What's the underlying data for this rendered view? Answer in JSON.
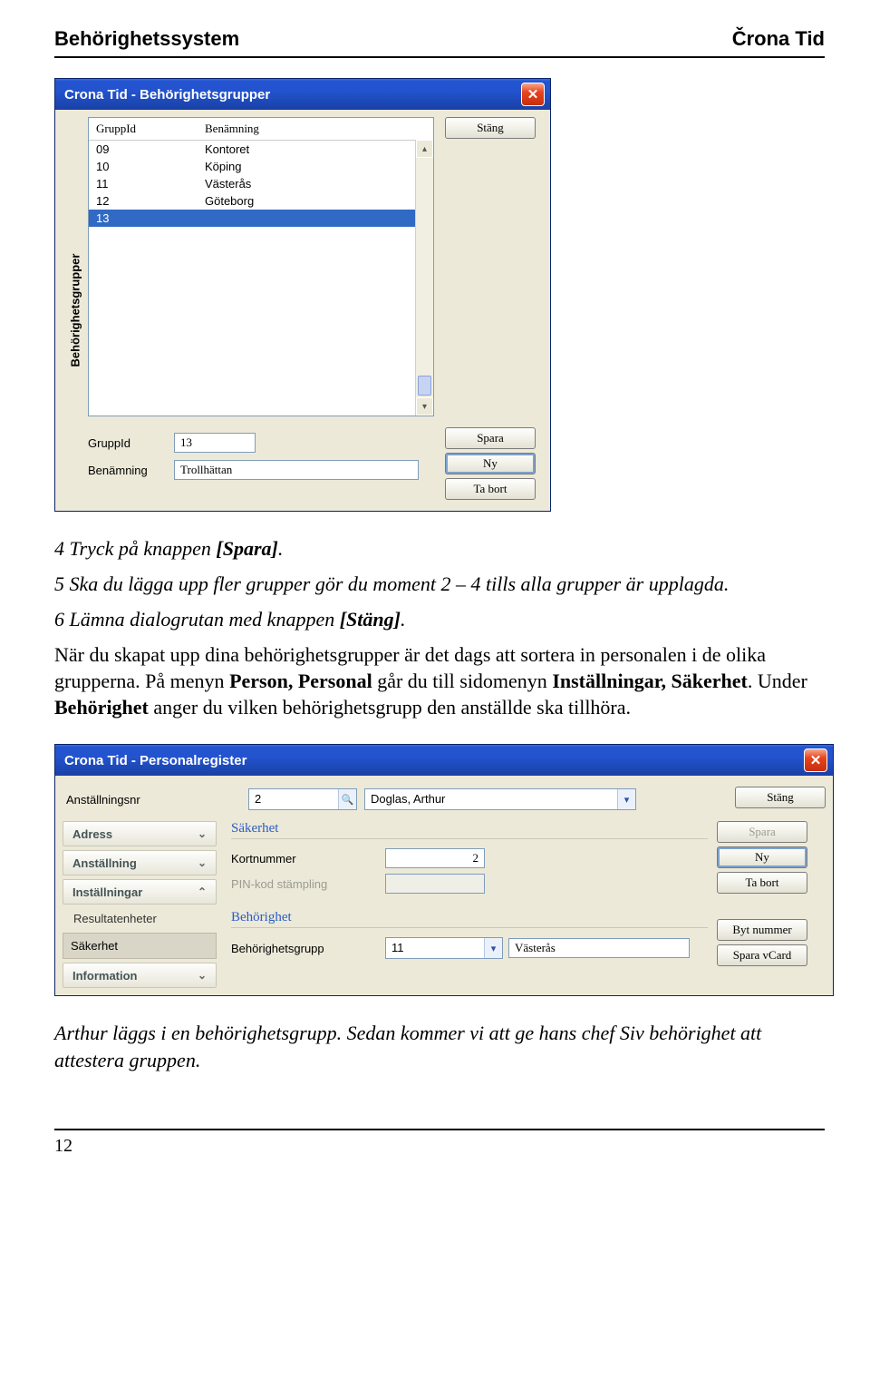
{
  "header": {
    "left": "Behörighetssystem",
    "right": "Črona Tid"
  },
  "dialog1": {
    "title": "Crona Tid - Behörighetsgrupper",
    "vtab": "Behörighetsgrupper",
    "headers": {
      "c1": "GruppId",
      "c2": "Benämning"
    },
    "rows": [
      {
        "id": "09",
        "name": "Kontoret",
        "selected": false
      },
      {
        "id": "10",
        "name": "Köping",
        "selected": false
      },
      {
        "id": "11",
        "name": "Västerås",
        "selected": false
      },
      {
        "id": "12",
        "name": "Göteborg",
        "selected": false
      },
      {
        "id": "13",
        "name": "",
        "selected": true
      }
    ],
    "closeBtn": "Stäng",
    "form": {
      "gruppid_label": "GruppId",
      "gruppid_value": "13",
      "benamning_label": "Benämning",
      "benamning_value": "Trollhättan"
    },
    "btns": {
      "spara": "Spara",
      "ny": "Ny",
      "tabort": "Ta bort"
    }
  },
  "body": {
    "p1_prefix": "4  Tryck på knappen ",
    "p1_bold": "[Spara]",
    "p1_suffix": ".",
    "p2": "5  Ska du lägga upp fler grupper gör du moment 2 – 4 tills alla grupper är upplagda.",
    "p3_prefix": "6  Lämna dialogrutan med knappen ",
    "p3_bold": "[Stäng]",
    "p3_suffix": ".",
    "p4_a": "När du skapat upp dina behörighetsgrupper är det dags att sortera in personalen i de olika grupperna. På menyn ",
    "p4_b": "Person, Personal",
    "p4_c": " går du till sidomenyn ",
    "p4_d": "Inställningar, Säkerhet",
    "p4_e": ". Under ",
    "p4_f": "Behörighet",
    "p4_g": " anger du vilken behörighetsgrupp den anställde ska tillhöra."
  },
  "dialog2": {
    "title": "Crona Tid - Personalregister",
    "top": {
      "label": "Anställningsnr",
      "value": "2",
      "name": "Doglas, Arthur",
      "close": "Stäng"
    },
    "nav": {
      "adress": "Adress",
      "anstallning": "Anställning",
      "installningar": "Inställningar",
      "resultat": "Resultatenheter",
      "sakerhet": "Säkerhet",
      "information": "Information"
    },
    "content": {
      "sakerhet_h": "Säkerhet",
      "kortnummer_label": "Kortnummer",
      "kortnummer_value": "2",
      "pin_label": "PIN-kod stämpling",
      "behorighet_h": "Behörighet",
      "grupp_label": "Behörighetsgrupp",
      "grupp_value": "11",
      "grupp_text": "Västerås"
    },
    "btns": {
      "spara": "Spara",
      "ny": "Ny",
      "tabort": "Ta bort",
      "bytnummer": "Byt nummer",
      "sparavcard": "Spara vCard"
    }
  },
  "caption": "Arthur läggs i en behörighetsgrupp. Sedan kommer vi att ge hans chef Siv behörighet att attestera gruppen.",
  "footer": "12"
}
